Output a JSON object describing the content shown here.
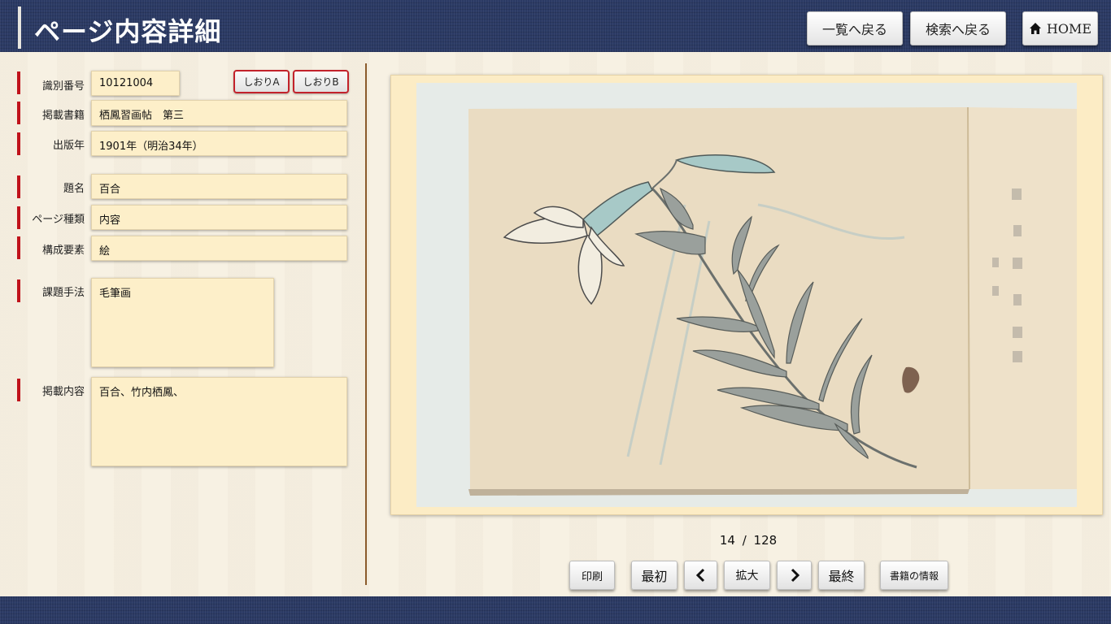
{
  "header": {
    "title": "ページ内容詳細",
    "back_to_list": "一覧へ戻る",
    "back_to_search": "検索へ戻る",
    "home": "HOME"
  },
  "bookmarks": {
    "a": "しおりA",
    "b": "しおりB"
  },
  "fields": {
    "id": {
      "label": "識別番号",
      "value": "10121004"
    },
    "book": {
      "label": "掲載書籍",
      "value": "栖鳳習画帖　第三"
    },
    "year": {
      "label": "出版年",
      "value": "1901年（明治34年）"
    },
    "subject": {
      "label": "題名",
      "value": "百合"
    },
    "page_type": {
      "label": "ページ種類",
      "value": "内容"
    },
    "element": {
      "label": "構成要素",
      "value": "絵"
    },
    "technique": {
      "label": "課題手法",
      "value": "毛筆画"
    },
    "content": {
      "label": "掲載内容",
      "value": "百合、竹内栖鳳、"
    }
  },
  "pager": {
    "current": "14",
    "separator": "/",
    "total": "128",
    "print": "印刷",
    "first": "最初",
    "zoom": "拡大",
    "last": "最終",
    "book_info": "書籍の情報"
  },
  "colors": {
    "header_bg": "#2b3a64",
    "accent_red": "#c0121b",
    "field_bg": "#fdefc9"
  }
}
